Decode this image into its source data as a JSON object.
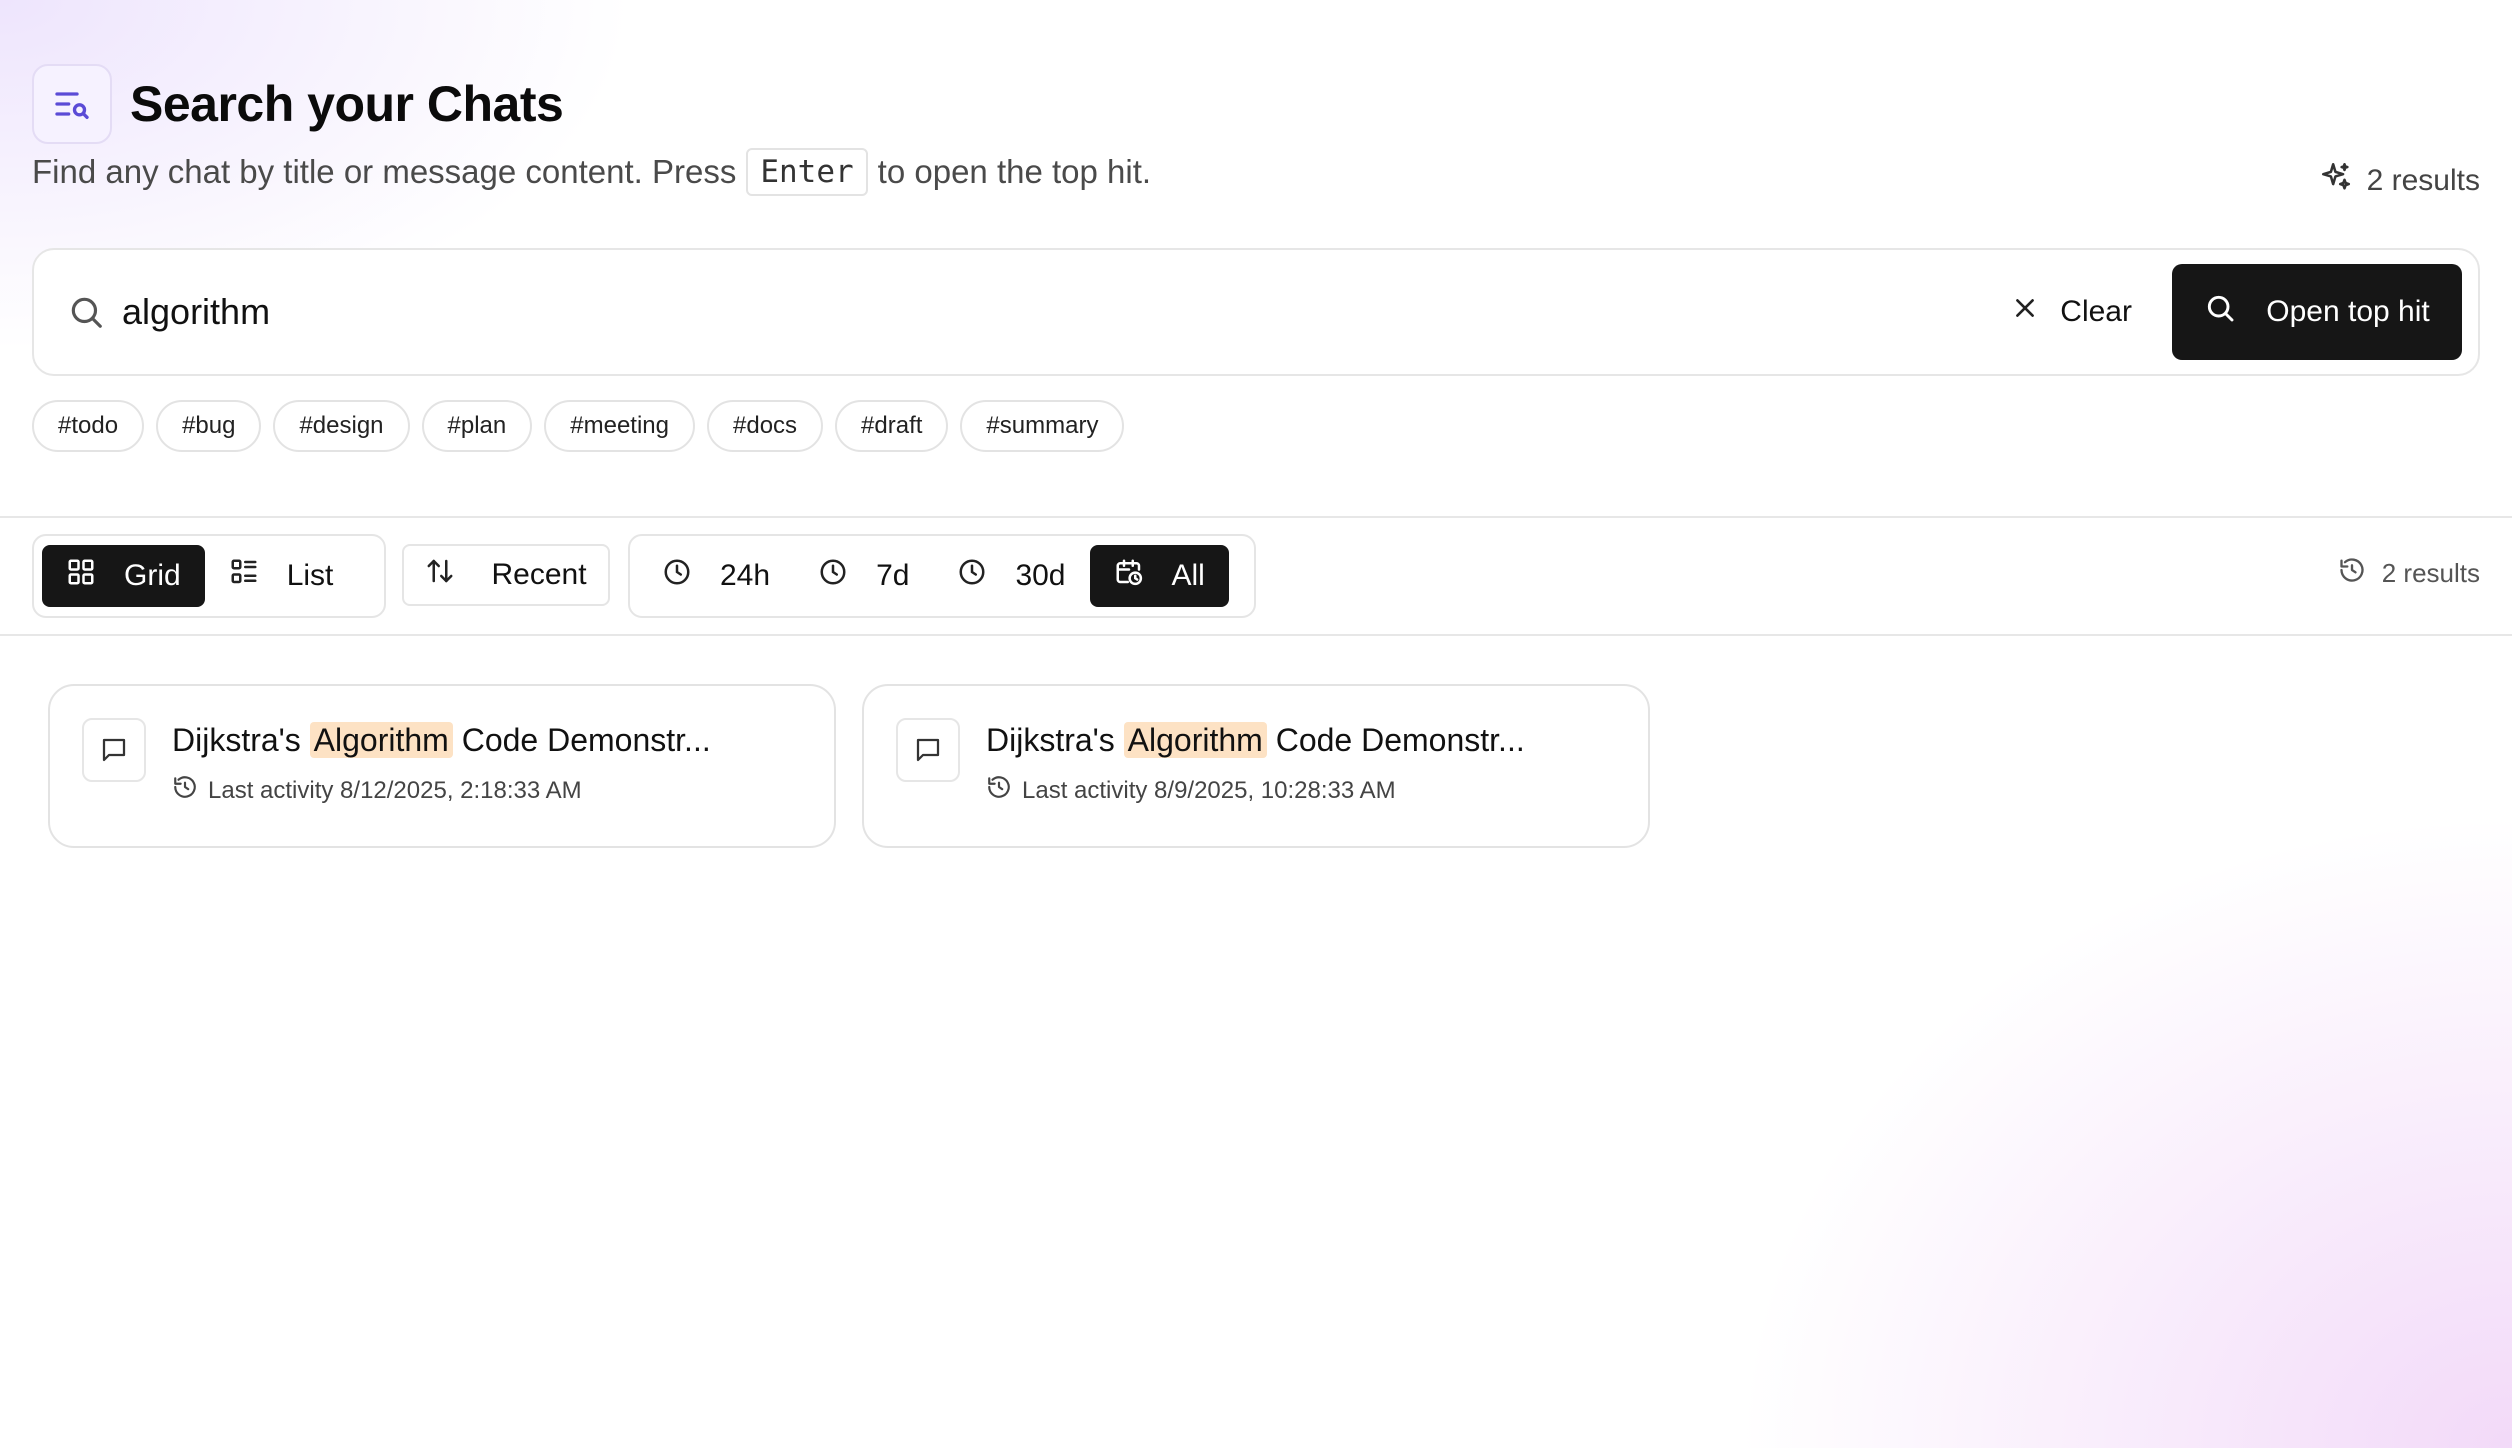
{
  "header": {
    "title": "Search your Chats",
    "subtitle_before": "Find any chat by title or message content. Press",
    "subtitle_key": "Enter",
    "subtitle_after": "to open the top hit.",
    "results_count": "2 results"
  },
  "search": {
    "value": "algorithm",
    "clear_label": "Clear",
    "open_label": "Open top hit"
  },
  "tags": [
    "#todo",
    "#bug",
    "#design",
    "#plan",
    "#meeting",
    "#docs",
    "#draft",
    "#summary"
  ],
  "toolbar": {
    "view_grid": "Grid",
    "view_list": "List",
    "sort_label": "Recent",
    "range_24h": "24h",
    "range_7d": "7d",
    "range_30d": "30d",
    "range_all": "All",
    "active_view": "Grid",
    "active_range": "All",
    "results_count": "2 results"
  },
  "cards": [
    {
      "title_before": "Dijkstra's",
      "title_highlight": "Algorithm",
      "title_after": "Code Demonstr...",
      "meta": "Last activity 8/12/2025, 2:18:33 AM"
    },
    {
      "title_before": "Dijkstra's",
      "title_highlight": "Algorithm",
      "title_after": "Code Demonstr...",
      "meta": "Last activity 8/9/2025, 10:28:33 AM"
    }
  ],
  "colors": {
    "accent": "#5b4bd6",
    "highlight": "#fde2c4",
    "dark_button": "#161616"
  }
}
